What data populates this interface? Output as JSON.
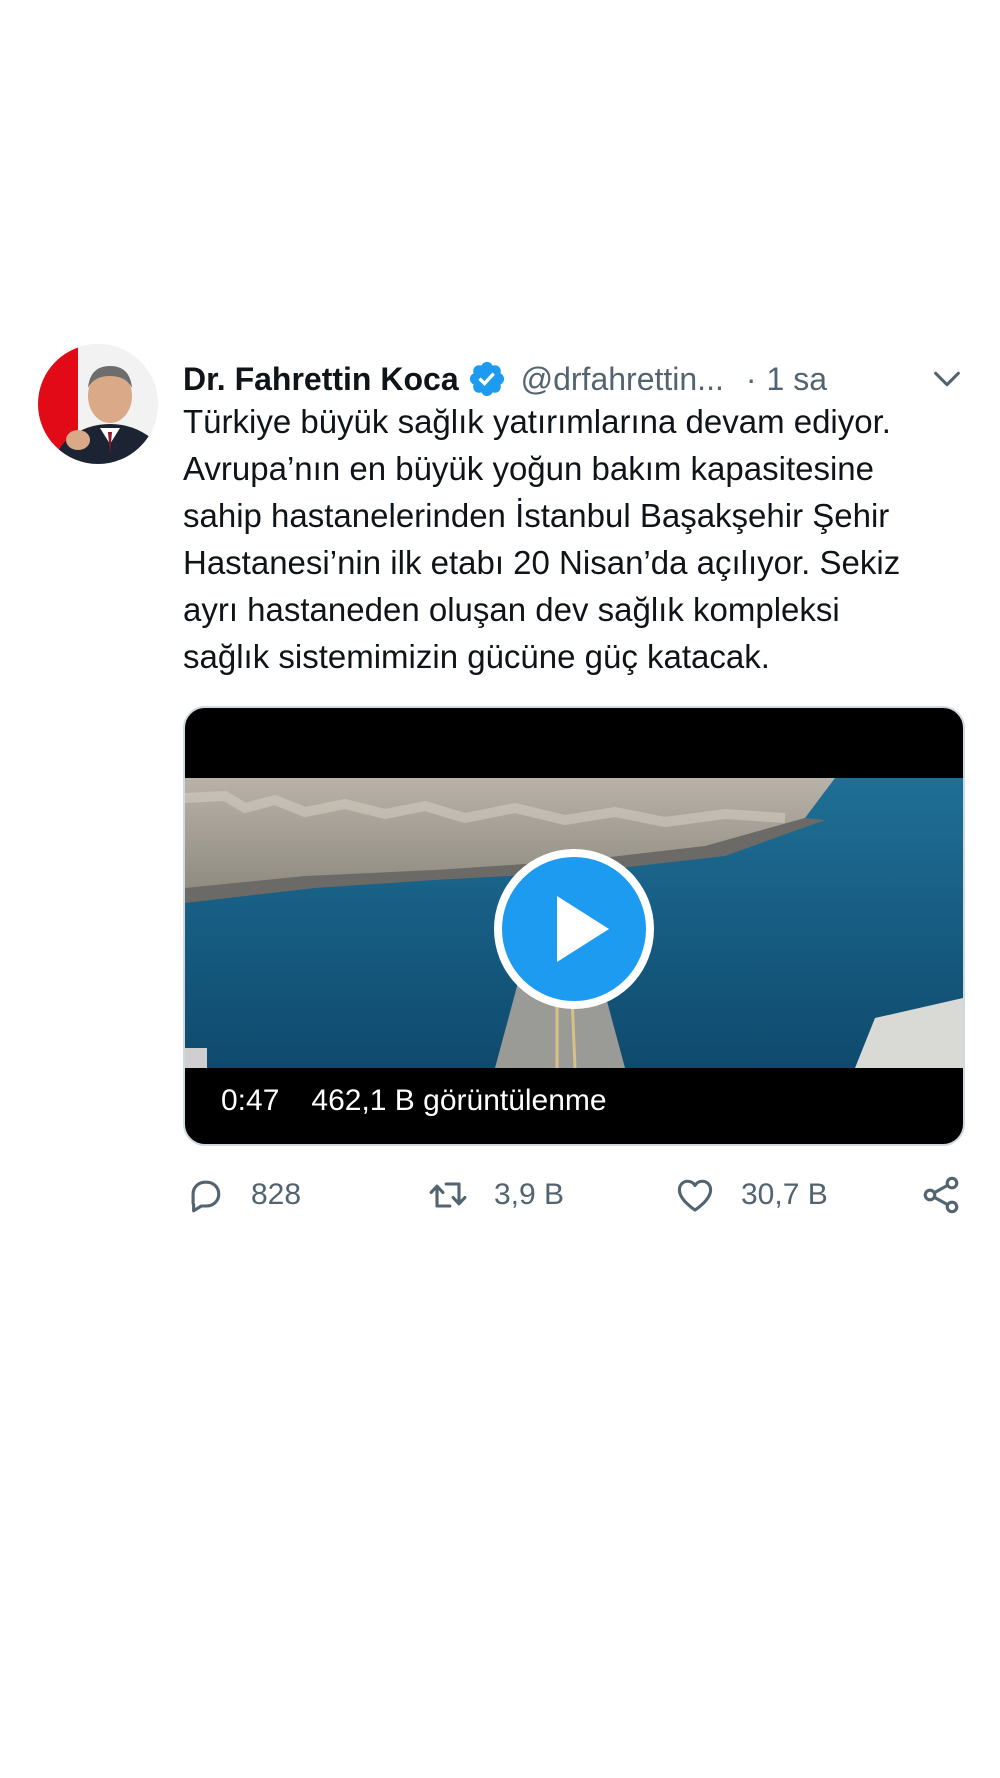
{
  "tweet": {
    "author_name": "Dr. Fahrettin Koca",
    "handle": "@drfahrettin...",
    "separator": "·",
    "time": "1 sa",
    "text_lines": [
      "Türkiye büyük sağlık yatırımlarına devam ediyor.",
      "Avrupa’nın en büyük yoğun bakım kapasitesine",
      "sahip hastanelerinden İstanbul Başakşehir Şehir",
      "Hastanesi’nin ilk etabı 20 Nisan’da açılıyor. Sekiz",
      "ayrı hastaneden oluşan dev sağlık kompleksi",
      "sağlık sistemimizin gücüne güç katacak."
    ],
    "media": {
      "duration": "0:47",
      "views": "462,1 B görüntülenme"
    },
    "actions": {
      "replies": "828",
      "retweets": "3,9 B",
      "likes": "30,7 B"
    }
  },
  "icons": {
    "verified": "verified-badge-icon",
    "more": "chevron-down-icon",
    "play": "play-icon",
    "reply": "reply-icon",
    "retweet": "retweet-icon",
    "like": "heart-icon",
    "share": "share-icon"
  },
  "colors": {
    "accent": "#1d9bf0",
    "secondary_text": "#536471",
    "primary_text": "#0f1419",
    "media_background": "#000000"
  }
}
